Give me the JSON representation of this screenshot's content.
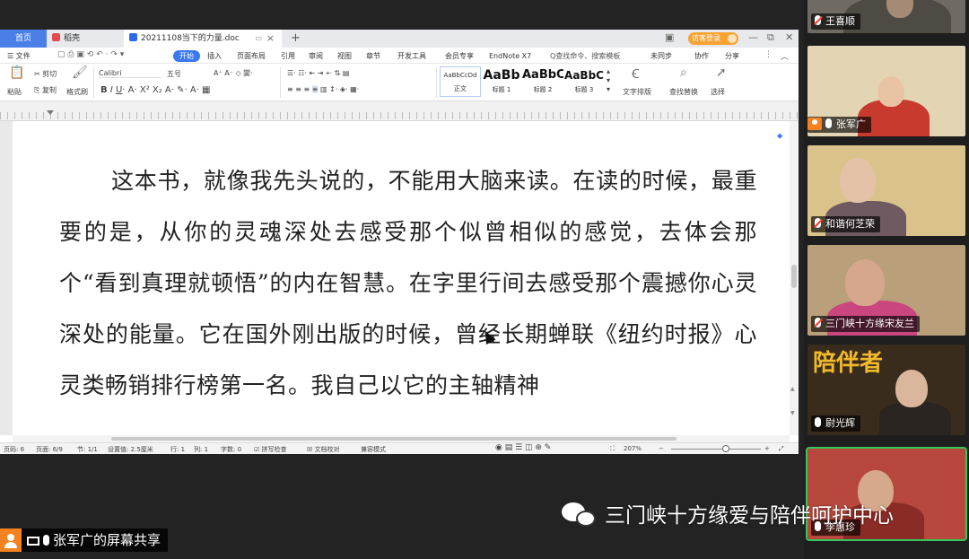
{
  "tabs": {
    "home": "首页",
    "wps": "稻壳",
    "doc": "20211108当下的力量.doc",
    "plus": "+"
  },
  "window": {
    "login": "访客登录",
    "controls": [
      "—",
      "⧉",
      "✕"
    ]
  },
  "menu": {
    "file": "☰ 文件",
    "items": [
      "开始",
      "插入",
      "页面布局",
      "引用",
      "审阅",
      "视图",
      "章节",
      "开发工具",
      "会员专享",
      "EndNote X7"
    ],
    "search": "Q查找命令、搜索模板",
    "right": [
      "未同步",
      "协作",
      "分享"
    ]
  },
  "ribbon": {
    "paste": "粘贴",
    "cut": "剪切",
    "copy": "复制",
    "format_painter": "格式刷",
    "font_name": "Calibri",
    "font_size": "五号",
    "styles": [
      {
        "preview": "AaBbCcDd",
        "name": "正文"
      },
      {
        "preview": "AaBb",
        "name": "标题 1"
      },
      {
        "preview": "AaBbC",
        "name": "标题 2"
      },
      {
        "preview": "AaBbC",
        "name": "标题 3"
      }
    ],
    "text_layout": "文字排版",
    "find_replace": "查找替换",
    "select": "选择"
  },
  "document": {
    "text": "这本书，就像我先头说的，不能用大脑来读。在读的时候，最重要的是，从你的灵魂深处去感受那个似曾相似的感觉，去体会那个“看到真理就顿悟”的内在智慧。在字里行间去感受那个震撼你心灵深处的能量。它在国外刚出版的时候，曾经长期蝉联《纽约时报》心灵类畅销排行榜第一名。我自己以它的主轴精神"
  },
  "status": {
    "page_num": "页码: 6",
    "pages": "页面: 6/9",
    "section": "节: 1/1",
    "setting": "设置值: 2.5厘米",
    "row": "行: 1",
    "col": "列: 1",
    "words": "字数: 0",
    "spell": "拼写检查",
    "proof": "文档校对",
    "compat": "兼容模式",
    "zoom": "207%"
  },
  "participants": [
    {
      "name": "王喜顺",
      "muted": true,
      "bg": "#6f6a63",
      "face": "#a58a76",
      "body": "#4e4a44"
    },
    {
      "name": "张军广",
      "muted": false,
      "host": true,
      "bg": "#e3d5b4",
      "face": "#e9c4a4",
      "body": "#c83a2d"
    },
    {
      "name": "和谐何芝荣",
      "muted": true,
      "bg": "#d9c38a",
      "face": "#e4c2a8",
      "body": "#6e5a60"
    },
    {
      "name": "三门峡十方缘宋友兰",
      "muted": true,
      "bg": "#b99f7a",
      "face": "#d6a68d",
      "body": "#c9477e"
    },
    {
      "name": "尉光辉",
      "muted": false,
      "bg": "#3a2c1d",
      "face": "#d9b69c",
      "body": "#2a2520",
      "sign": "陪伴者"
    },
    {
      "name": "李惠珍",
      "muted": false,
      "active": true,
      "bg": "#b8483d",
      "face": "#d7a98c",
      "body": "#8a2b25"
    }
  ],
  "share": {
    "label": "张军广的屏幕共享"
  },
  "watermark": {
    "text": "三门峡十方缘爱与陪伴呵护中心"
  }
}
